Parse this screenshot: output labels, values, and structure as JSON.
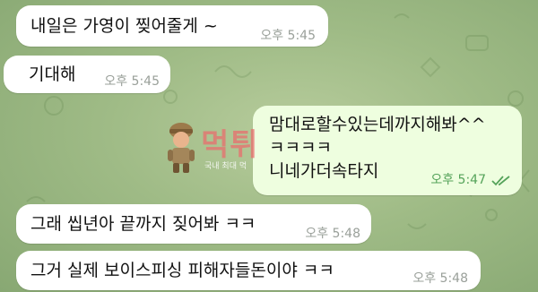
{
  "messages": [
    {
      "direction": "in",
      "text": "내일은 가영이 찢어줄게 ~",
      "time": "오후 5:45"
    },
    {
      "direction": "in",
      "text": "기대해",
      "time": "오후 5:45"
    },
    {
      "direction": "out",
      "lines": [
        "맘대로할수있는데까지해봐^^",
        "ㅋㅋㅋㅋ",
        "니네가더속타지"
      ],
      "time": "오후 5:47",
      "status_icon": "double-check-icon"
    },
    {
      "direction": "in",
      "text": "그래 씹년아 끝까지 짖어봐 ㅋㅋ",
      "time": "오후 5:48"
    },
    {
      "direction": "in",
      "text": "그거 실제 보이스피싱 피해자들돈이야 ㅋㅋ",
      "time": "오후 5:48"
    }
  ],
  "watermark": {
    "title": "먹튀",
    "subtitle": "국내 최대 먹",
    "figure_icon": "soldier-mascot-icon"
  },
  "colors": {
    "incoming_bubble": "#ffffff",
    "outgoing_bubble": "#eefedf",
    "outgoing_time": "#55a35a",
    "wallpaper": "#a6c08c"
  }
}
